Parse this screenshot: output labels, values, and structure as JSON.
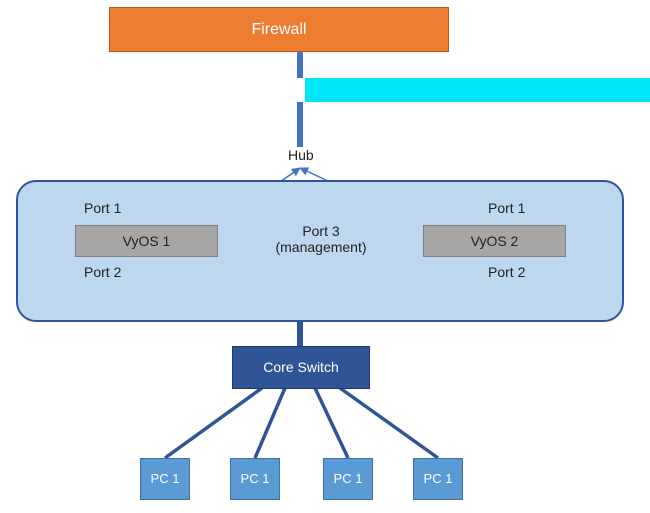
{
  "firewall": {
    "label": "Firewall"
  },
  "hub": {
    "label": "Hub"
  },
  "group": {
    "vyos1": {
      "label": "VyOS 1",
      "port1": "Port 1",
      "port2": "Port 2"
    },
    "vyos2": {
      "label": "VyOS 2",
      "port1": "Port 1",
      "port2": "Port 2"
    },
    "port3": {
      "line1": "Port 3",
      "line2": "(management)"
    }
  },
  "core": {
    "label": "Core Switch"
  },
  "pcs": {
    "pc1": "PC 1",
    "pc2": "PC 1",
    "pc3": "PC 1",
    "pc4": "PC 1"
  },
  "colors": {
    "firewall": "#ED7D31",
    "cyan": "#00E5F7",
    "cloud": "#BDD7EE",
    "cloudBorder": "#2F5597",
    "vyos": "#A6A6A6",
    "core": "#2F5597",
    "pc": "#5B9BD5",
    "line": "#4472C4"
  }
}
